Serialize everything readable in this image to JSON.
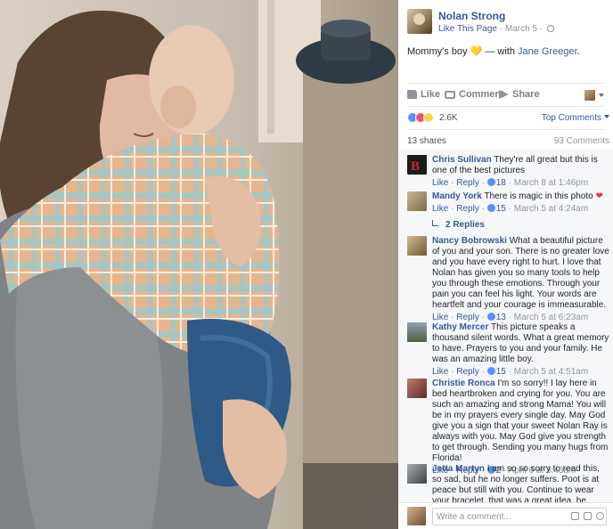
{
  "post": {
    "page_name": "Nolan Strong",
    "like_page": "Like This Page",
    "date": "March 5",
    "text_lead": "Mommy's boy",
    "heart": "💛",
    "with_prefix": "— with",
    "tagged": "Jane Greeger",
    "tagged_suffix": "."
  },
  "actions": {
    "like": "Like",
    "comment": "Comment",
    "share": "Share"
  },
  "reactions": {
    "count": "2.6K",
    "sort": "Top Comments"
  },
  "shares": {
    "shares": "13 shares",
    "comments": "93 Comments"
  },
  "comment_meta": {
    "like": "Like",
    "reply": "Reply",
    "dot": "·"
  },
  "comments": [
    {
      "name": "Chris Sullivan",
      "text": "They're all great but this is one of the best pictures",
      "likes": "18",
      "time": "March 8 at 1:46pm",
      "avatar_color": "#1b1b1b"
    },
    {
      "name": "Mandy York",
      "text": "There is magic in this photo",
      "emoji": "❤",
      "likes": "15",
      "time": "March 5 at 4:24am",
      "avatar_color": "#9c8a6a"
    },
    {
      "name": "Nancy Bobrowski",
      "text": "What a beautiful picture of you and your son. There is no greater love and you have every right to hurt. I love that Nolan has given you so many tools to help you through these emotions. Through your pain you can feel his light. Your words are heartfelt and your courage is immeasurable.",
      "likes": "13",
      "time": "March 5 at 6:23am",
      "avatar_color": "#8a7a52"
    },
    {
      "name": "Kathy Mercer",
      "text": "This picture speaks a thousand silent words. What a great memory to have. Prayers to you and your family. He was an amazing little boy.",
      "likes": "15",
      "time": "March 5 at 4:51am",
      "avatar_color": "#5e6b4f"
    },
    {
      "name": "Christie Ronca",
      "text": "I'm so sorry!! I lay here in bed heartbroken and crying for you. You are such an amazing and strong Mama! You will be in my prayers every single day. May God give you a sign that your sweet Nolan Ray is always with you. May God give you strength to get through. Sending you many hugs from Florida!",
      "likes": "2",
      "time": "April 6 at 3:43am",
      "avatar_color": "#a64b4b"
    },
    {
      "name": "Jetta Martyn",
      "text": "I am so so sorry to read this, so sad, but he no longer suffers. Poot is at peace but still with you. Continue to wear your bracelet, that was a great idea, be strong for your other two babies an",
      "avatar_color": "#6a6e73"
    }
  ],
  "replies": "2 Replies",
  "composer": {
    "placeholder": "Write a comment..."
  },
  "icons": [
    "globe-icon",
    "like-icon",
    "comment-icon",
    "share-icon",
    "caret-down-icon",
    "like-reaction-icon",
    "love-reaction-icon",
    "sad-reaction-icon",
    "reply-arrow-icon",
    "emoji-icon",
    "camera-icon",
    "sticker-icon"
  ],
  "colors": {
    "link": "#365899",
    "muted": "#90949c",
    "panel": "#ffffff",
    "comments_bg": "#f6f7f9"
  }
}
